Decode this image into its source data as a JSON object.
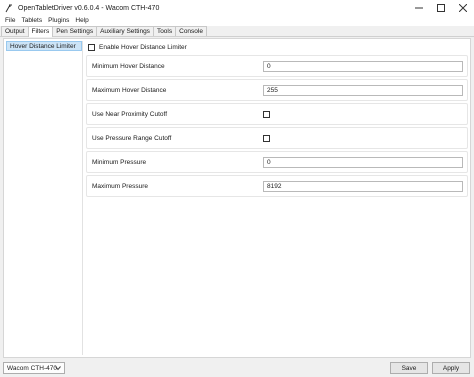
{
  "window": {
    "title": "OpenTabletDriver v0.6.0.4 - Wacom CTH-470",
    "controls": [
      "minimize-icon",
      "maximize-icon",
      "close-icon"
    ]
  },
  "menu": [
    "File",
    "Tablets",
    "Plugins",
    "Help"
  ],
  "tabs": [
    {
      "label": "Output",
      "active": false
    },
    {
      "label": "Filters",
      "active": true
    },
    {
      "label": "Pen Settings",
      "active": false
    },
    {
      "label": "Auxiliary Settings",
      "active": false
    },
    {
      "label": "Tools",
      "active": false
    },
    {
      "label": "Console",
      "active": false
    }
  ],
  "sidebar": {
    "items": [
      {
        "label": "Hover Distance Limiter",
        "selected": true
      }
    ]
  },
  "filter": {
    "enable_label": "Enable Hover Distance Limiter",
    "enabled": false,
    "settings": [
      {
        "label": "Minimum Hover Distance",
        "type": "text",
        "value": "0"
      },
      {
        "label": "Maximum Hover Distance",
        "type": "text",
        "value": "255"
      },
      {
        "label": "Use Near Proximity Cutoff",
        "type": "checkbox",
        "checked": false
      },
      {
        "label": "Use Pressure Range Cutoff",
        "type": "checkbox",
        "checked": false
      },
      {
        "label": "Minimum Pressure",
        "type": "text",
        "value": "0"
      },
      {
        "label": "Maximum Pressure",
        "type": "text",
        "value": "8192"
      }
    ]
  },
  "footer": {
    "device": "Wacom CTH-470",
    "save_label": "Save",
    "apply_label": "Apply"
  },
  "colors": {
    "selection": "#cce4f7",
    "selection_border": "#99c9ef",
    "window_bg": "#f0f0f0"
  }
}
